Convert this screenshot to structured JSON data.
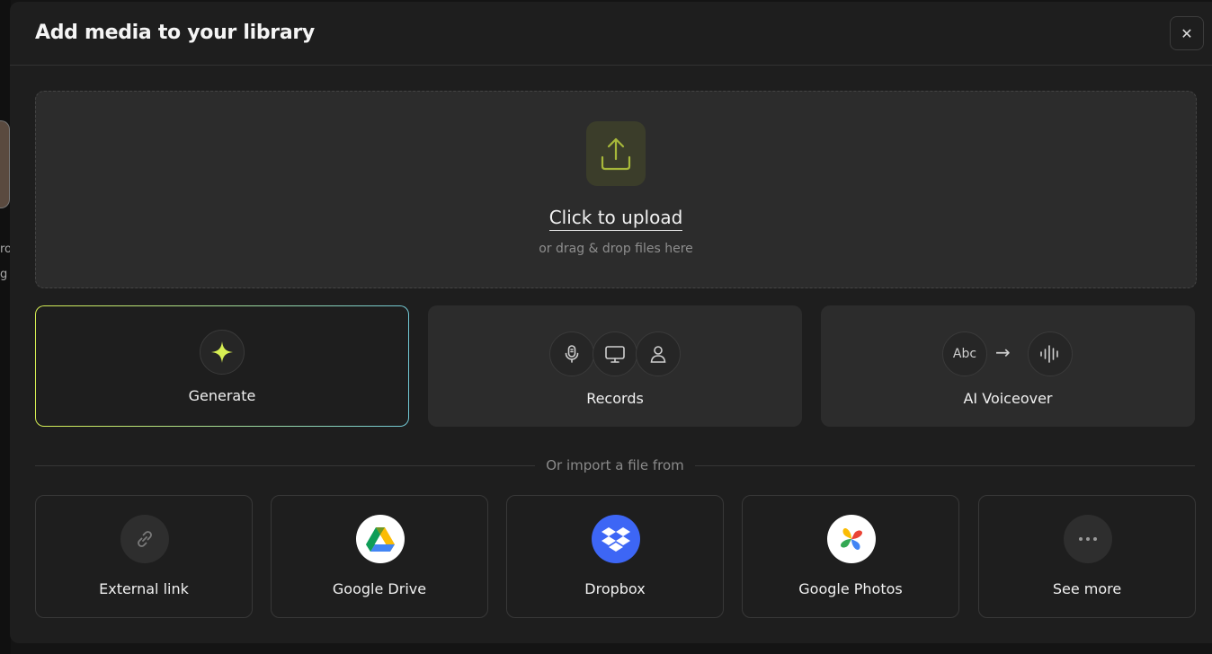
{
  "backdrop": {
    "text_line_1": "ro",
    "text_line_2": "g"
  },
  "modal": {
    "title": "Add media to your library",
    "close_symbol": "✕"
  },
  "upload": {
    "icon": "upload-icon",
    "label": "Click to upload",
    "subtext": "or drag & drop files here"
  },
  "actions": [
    {
      "id": "generate",
      "label": "Generate",
      "icons": [
        "sparkle-icon"
      ]
    },
    {
      "id": "records",
      "label": "Records",
      "icons": [
        "microphone-icon",
        "monitor-icon",
        "user-icon"
      ]
    },
    {
      "id": "ai-voiceover",
      "label": "AI Voiceover",
      "text_chip": "Abc",
      "arrow": "→",
      "icons": [
        "text-chip",
        "arrow-icon",
        "waveform-icon"
      ]
    }
  ],
  "import": {
    "divider_text": "Or import a file from",
    "sources": [
      {
        "label": "External link",
        "icon": "link-icon"
      },
      {
        "label": "Google Drive",
        "icon": "google-drive-icon"
      },
      {
        "label": "Dropbox",
        "icon": "dropbox-icon"
      },
      {
        "label": "Google Photos",
        "icon": "google-photos-icon"
      },
      {
        "label": "See more",
        "icon": "more-dots-icon"
      }
    ]
  },
  "colors": {
    "background": "#1e1e1e",
    "card": "#2c2c2c",
    "accent_yellow": "#d7ef53",
    "accent_teal": "#72c9d6",
    "dropbox_blue": "#3d66f5"
  }
}
